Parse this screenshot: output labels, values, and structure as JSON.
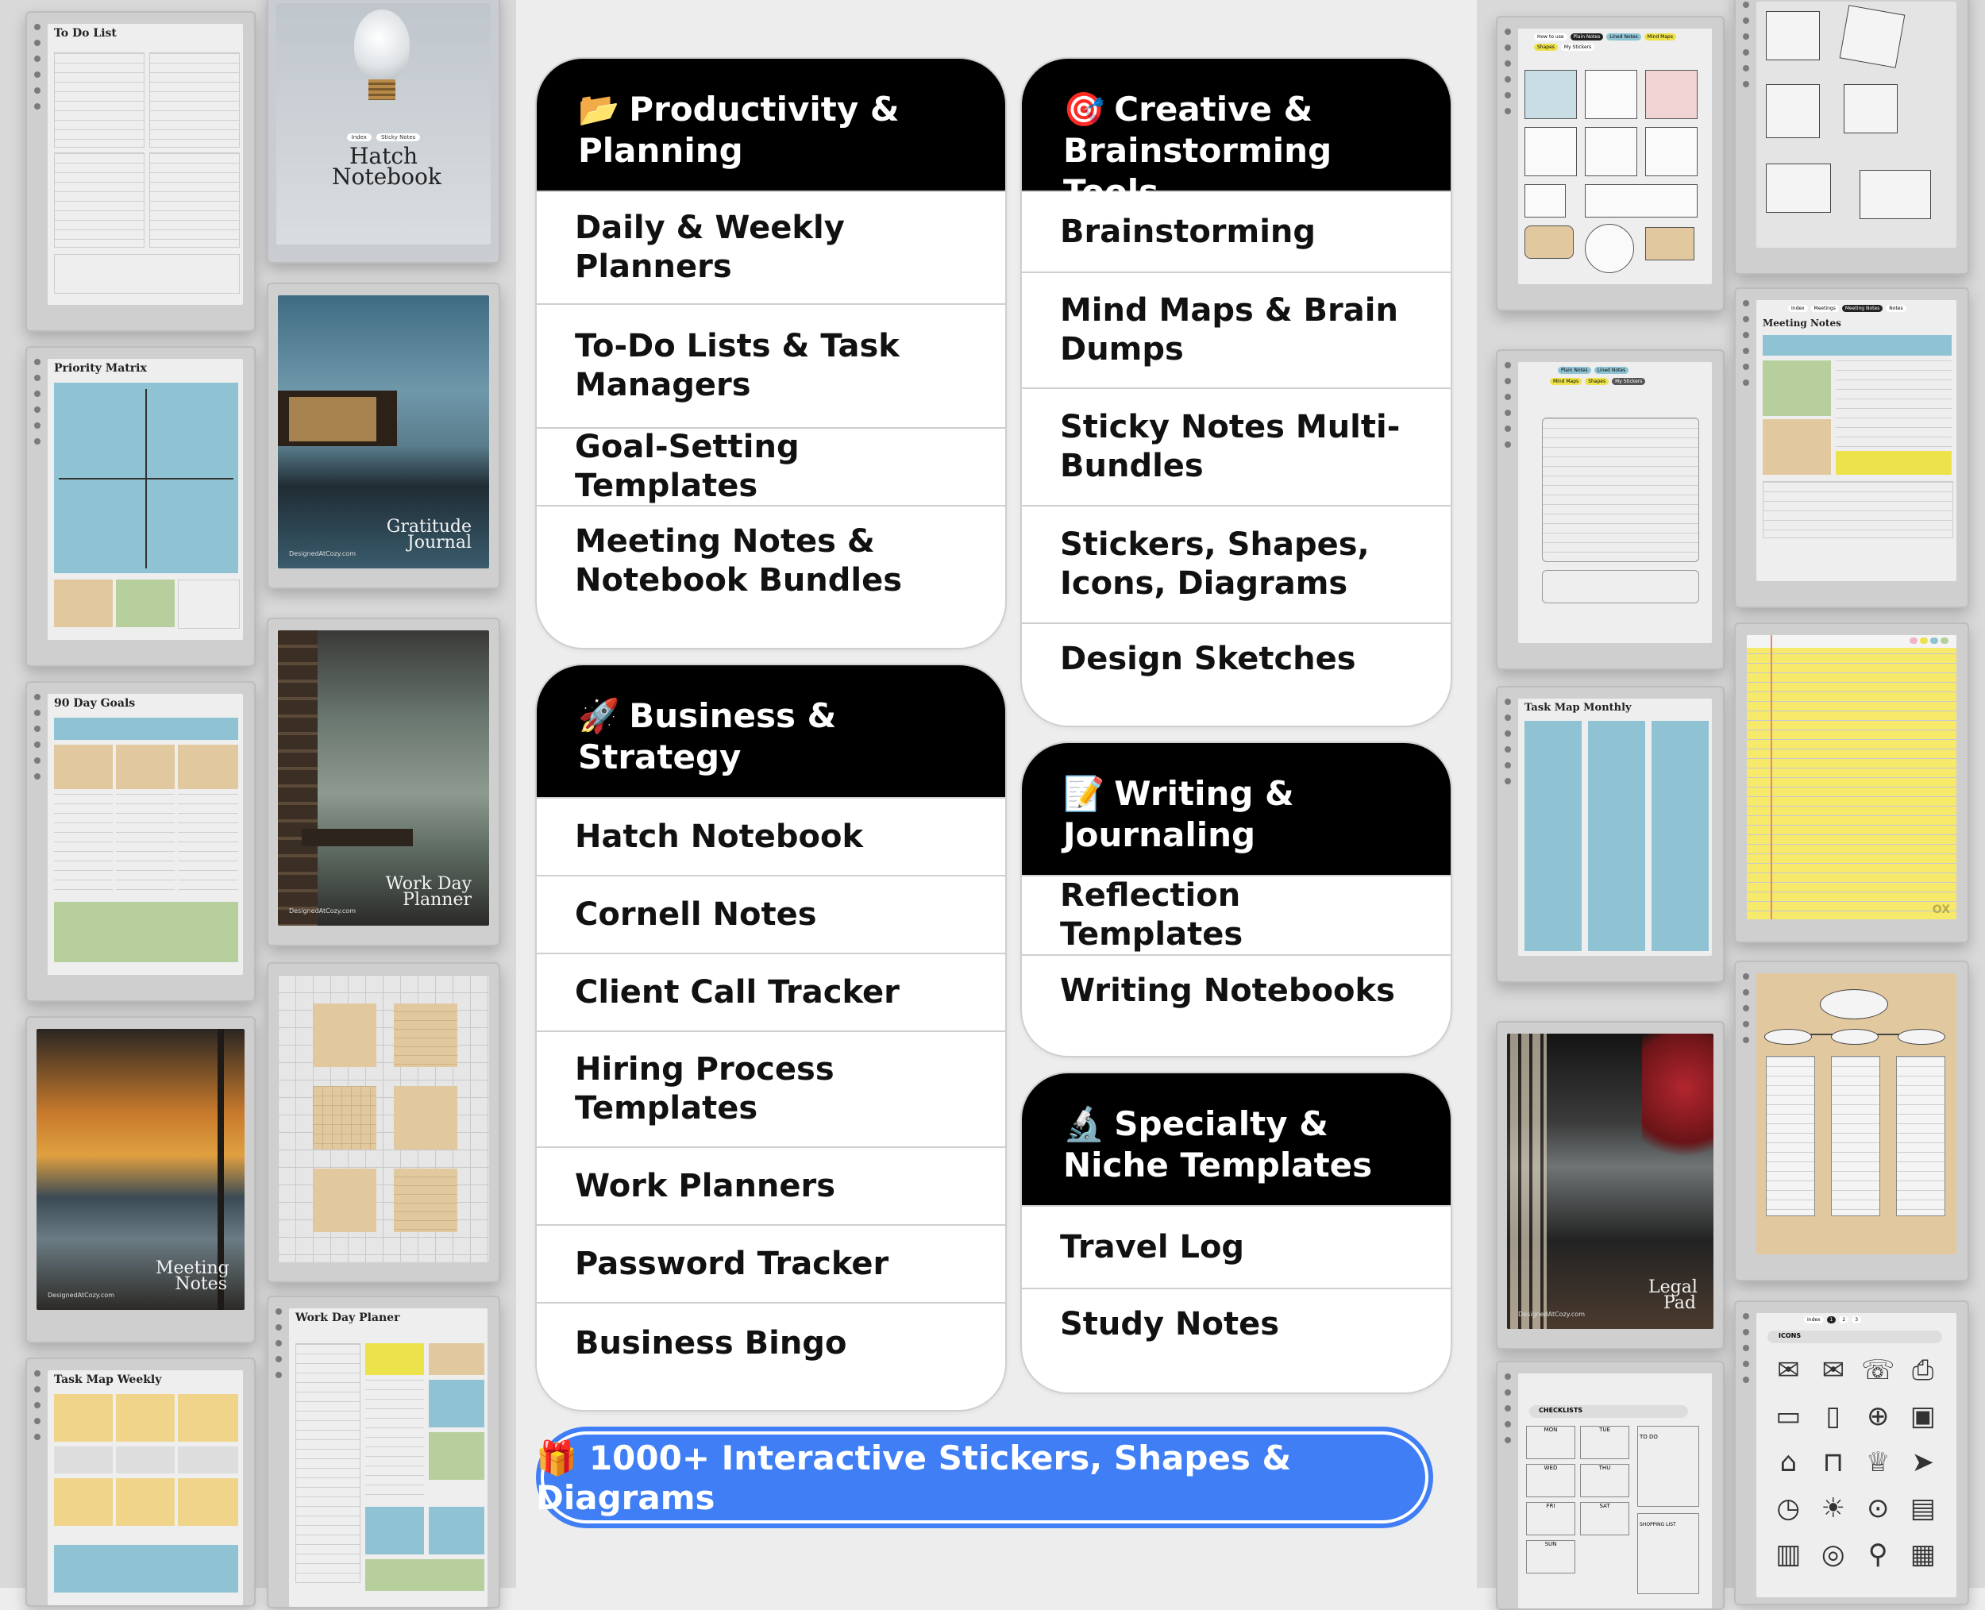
{
  "left_column_1": {
    "todo_title": "To Do List",
    "priority_title": "Priority Matrix",
    "goals_title": "90 Day Goals",
    "task_weekly_title": "Task Map Weekly"
  },
  "left_column_2": {
    "hatch_cover_title": "Hatch Notebook",
    "hatch_nav_1": "Index",
    "hatch_nav_2": "Sticky Notes",
    "gratitude_title": "Gratitude Journal",
    "workday_cover_title": "Work Day Planner",
    "meeting_cover_title": "Meeting Notes",
    "workday_planner_title": "Work Day Planer",
    "cover_credit": "DesignedAtCozy.com"
  },
  "right_column_1": {
    "stickers_tabs": [
      "How to use",
      "Plain Notes",
      "Lined Notes",
      "Mind Maps",
      "Shapes",
      "My Stickers"
    ],
    "task_map_monthly_title": "Task Map Monthly",
    "checklists_label": "CHECKLISTS",
    "checklist_days": [
      "MON",
      "TUE",
      "WED",
      "THU",
      "FRI",
      "SAT",
      "SUN"
    ],
    "todo_label": "TO DO",
    "shopping_label": "SHOPPING LIST"
  },
  "right_column_2": {
    "meeting_notes_title": "Meeting Notes",
    "meeting_tabs": [
      "Index",
      "Meetings",
      "Meeting Notes",
      "Notes"
    ],
    "legal_pad_title": "Legal Pad",
    "icons_label": "ICONS",
    "icons_tabs": [
      "Index",
      "1",
      "2",
      "3"
    ],
    "ox_mark": "OX"
  },
  "cards": {
    "productivity": {
      "emoji": "📂",
      "title": "Productivity & Planning",
      "items": [
        "Daily & Weekly Planners",
        "To-Do Lists & Task Managers",
        "Goal-Setting Templates",
        "Meeting Notes & Notebook Bundles"
      ]
    },
    "business": {
      "emoji": "🚀",
      "title": "Business & Strategy",
      "items": [
        "Hatch Notebook",
        "Cornell Notes",
        "Client Call Tracker",
        "Hiring Process Templates",
        "Work Planners",
        "Password Tracker",
        "Business Bingo"
      ]
    },
    "creative": {
      "emoji": "🎯",
      "title": "Creative & Brainstorming Tools",
      "items": [
        "Brainstorming",
        "Mind Maps & Brain Dumps",
        "Sticky Notes Multi-Bundles",
        "Stickers, Shapes, Icons, Diagrams",
        "Design Sketches"
      ]
    },
    "writing": {
      "emoji": "📝",
      "title": "Writing & Journaling",
      "items": [
        "Reflection Templates",
        "Writing Notebooks"
      ]
    },
    "specialty": {
      "emoji": "🔬",
      "title": "Specialty & Niche Templates",
      "items": [
        "Travel Log",
        "Study Notes"
      ]
    }
  },
  "banner": {
    "emoji": "🎁",
    "text": "1000+ Interactive Stickers, Shapes & Diagrams",
    "color": "#3f7ef5"
  },
  "colors": {
    "card_header": "#000000",
    "blue_panel": "#8fc3d3",
    "tan_panel": "#e2c89e",
    "green_panel": "#b7cf9c",
    "yellow_pad": "#f7ea6b"
  }
}
